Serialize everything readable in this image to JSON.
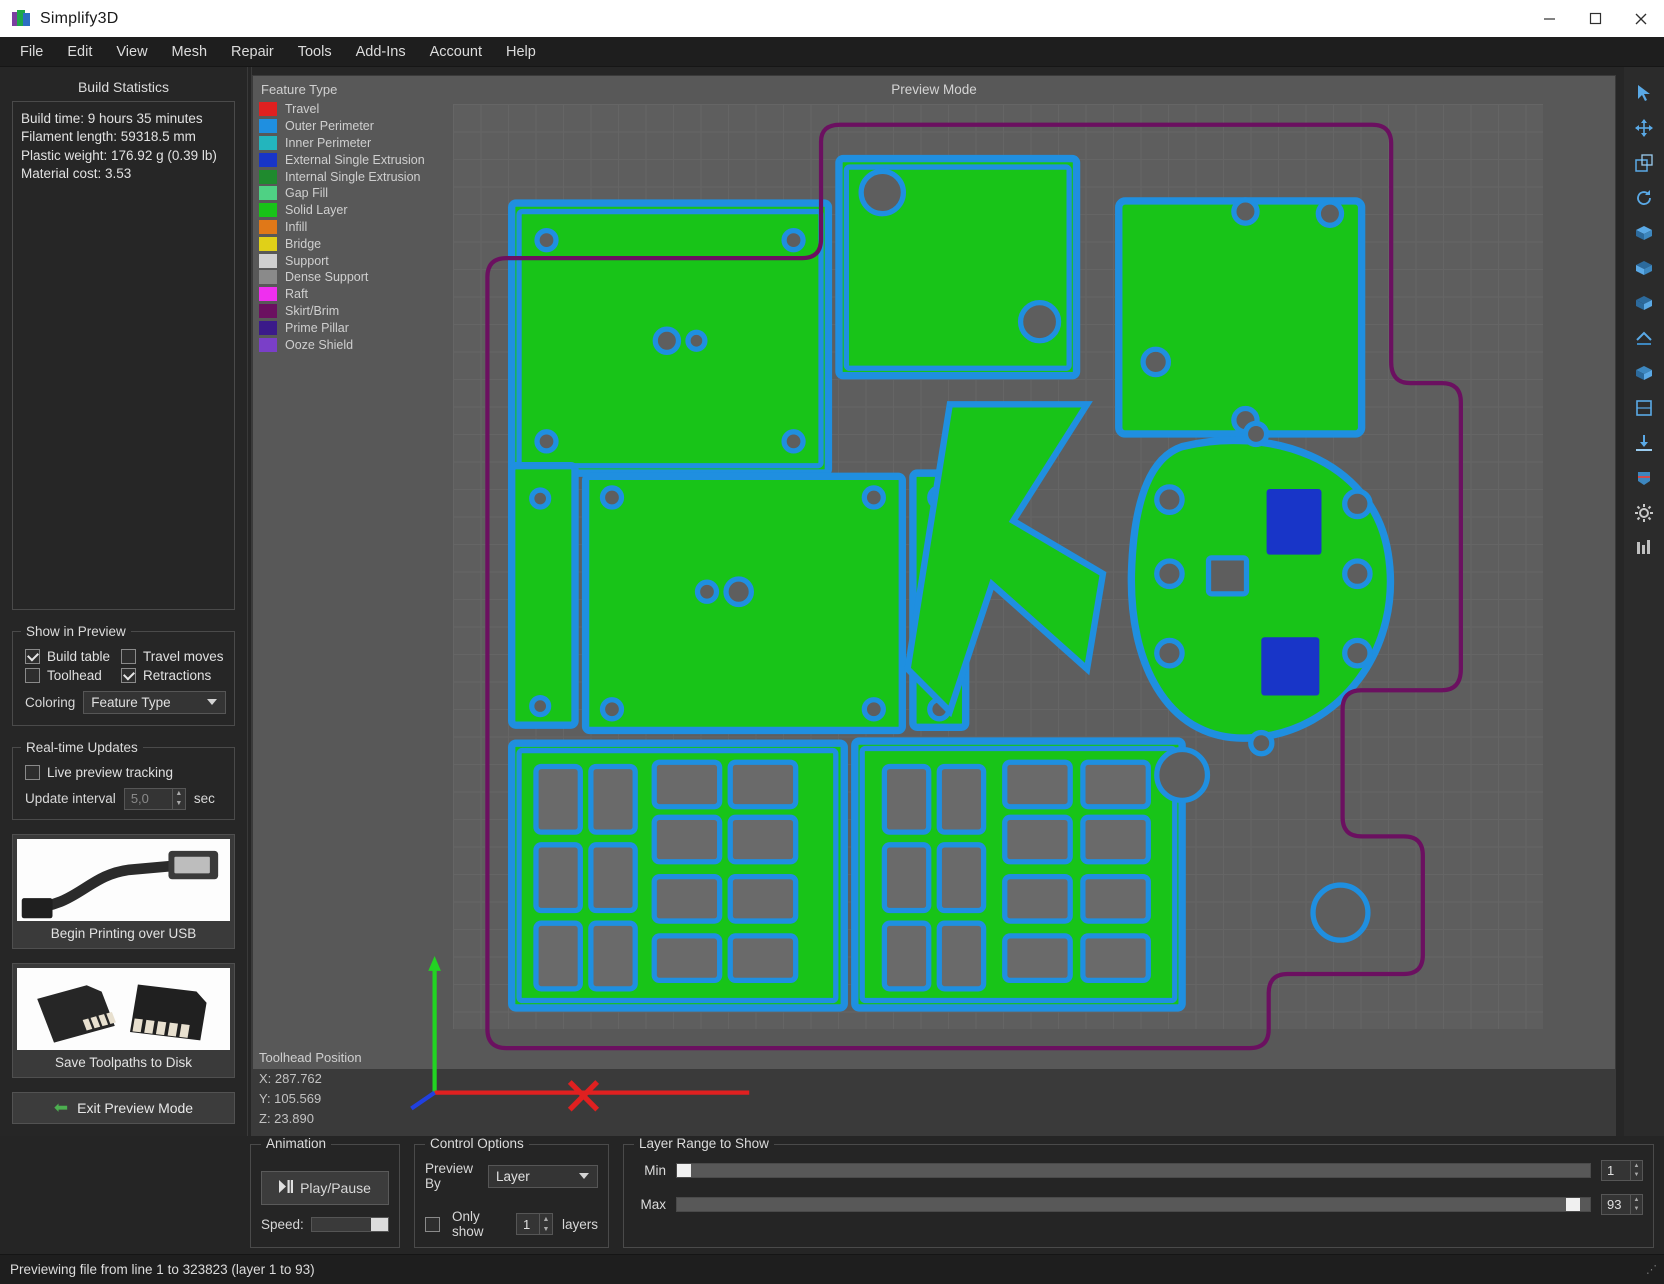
{
  "window": {
    "title": "Simplify3D",
    "minimize_label": "minimize",
    "maximize_label": "maximize",
    "close_label": "close"
  },
  "menu": {
    "items": [
      "File",
      "Edit",
      "View",
      "Mesh",
      "Repair",
      "Tools",
      "Add-Ins",
      "Account",
      "Help"
    ]
  },
  "left_panel": {
    "stats_title": "Build Statistics",
    "stats_lines": [
      "Build time: 9 hours 35 minutes",
      "Filament length: 59318.5 mm",
      "Plastic weight: 176.92 g (0.39 lb)",
      "Material cost: 3.53"
    ],
    "show_in_preview": {
      "legend": "Show in Preview",
      "build_table": {
        "label": "Build table",
        "checked": true
      },
      "travel_moves": {
        "label": "Travel moves",
        "checked": false
      },
      "toolhead": {
        "label": "Toolhead",
        "checked": false
      },
      "retractions": {
        "label": "Retractions",
        "checked": true
      },
      "coloring_label": "Coloring",
      "coloring_value": "Feature Type"
    },
    "realtime": {
      "legend": "Real-time Updates",
      "live_preview_label": "Live preview tracking",
      "live_preview_checked": false,
      "update_interval_label": "Update interval",
      "update_interval_value": "5,0",
      "update_interval_unit": "sec"
    },
    "usb_button_label": "Begin Printing over USB",
    "sd_button_label": "Save Toolpaths to Disk",
    "exit_button_label": "Exit Preview Mode"
  },
  "viewport": {
    "preview_mode_label": "Preview Mode",
    "legend_title": "Feature Type",
    "legend_items": [
      {
        "label": "Travel",
        "color": "#e02020"
      },
      {
        "label": "Outer Perimeter",
        "color": "#1f8fe0"
      },
      {
        "label": "Inner Perimeter",
        "color": "#23b5bd"
      },
      {
        "label": "External Single Extrusion",
        "color": "#1835c8"
      },
      {
        "label": "Internal Single Extrusion",
        "color": "#1f8a2e"
      },
      {
        "label": "Gap Fill",
        "color": "#4fd184"
      },
      {
        "label": "Solid Layer",
        "color": "#18c418"
      },
      {
        "label": "Infill",
        "color": "#e07818"
      },
      {
        "label": "Bridge",
        "color": "#e0d018"
      },
      {
        "label": "Support",
        "color": "#d0d0d0"
      },
      {
        "label": "Dense Support",
        "color": "#8a8a8a"
      },
      {
        "label": "Raft",
        "color": "#ef2fef"
      },
      {
        "label": "Skirt/Brim",
        "color": "#6b1060"
      },
      {
        "label": "Prime Pillar",
        "color": "#3b1a8a"
      },
      {
        "label": "Ooze Shield",
        "color": "#7a3fc8"
      }
    ],
    "toolhead_title": "Toolhead Position",
    "toolhead_x": "X: 287.762",
    "toolhead_y": "Y: 105.569",
    "toolhead_z": "Z: 23.890"
  },
  "right_toolbar": {
    "icons": [
      "cursor-select-icon",
      "move-icon",
      "scale-icon",
      "rotate-icon",
      "view-top-icon",
      "view-front-icon",
      "view-side-icon",
      "view-iso-icon",
      "view-bottom-icon",
      "view-corner-icon",
      "place-surface-icon",
      "cross-section-icon",
      "settings-gear-icon",
      "layers-icon"
    ]
  },
  "bottom": {
    "animation": {
      "legend": "Animation",
      "play_pause_label": "Play/Pause",
      "speed_label": "Speed:"
    },
    "control_options": {
      "legend": "Control Options",
      "preview_by_label": "Preview By",
      "preview_by_value": "Layer",
      "only_show_label": "Only show",
      "only_show_checked": false,
      "only_show_value": "1",
      "layers_label": "layers"
    },
    "layer_range": {
      "legend": "Layer Range to Show",
      "min_label": "Min",
      "min_value": "1",
      "max_label": "Max",
      "max_value": "93"
    }
  },
  "status_bar": {
    "text": "Previewing file from line 1 to 323823 (layer 1 to 93)"
  }
}
